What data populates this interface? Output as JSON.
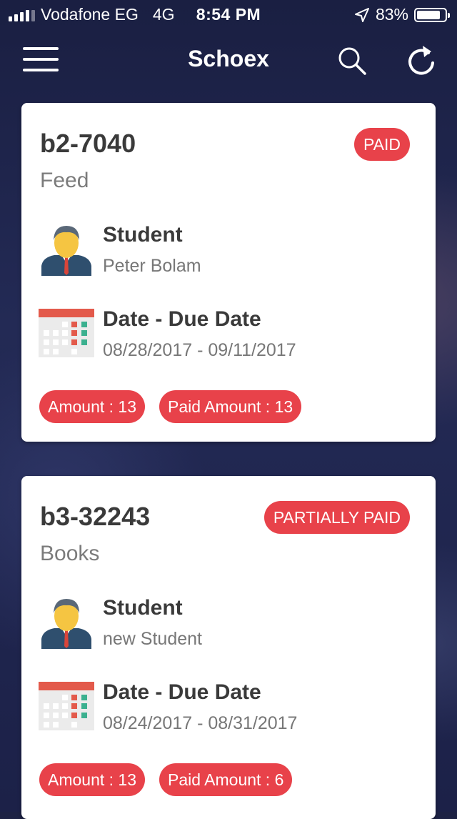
{
  "status_bar": {
    "carrier": "Vodafone EG",
    "network": "4G",
    "time": "8:54 PM",
    "battery": "83%",
    "battery_level": 0.83
  },
  "navbar": {
    "title": "Schoex",
    "icons": [
      "menu-icon",
      "search-icon",
      "refresh-icon"
    ]
  },
  "invoices": [
    {
      "id": "b2-7040",
      "type": "Feed",
      "status": "PAID",
      "student_label": "Student",
      "student_name": "Peter Bolam",
      "date_label": "Date - Due Date",
      "dates": "08/28/2017 - 09/11/2017",
      "amount": "Amount : 13",
      "paid_amount": "Paid Amount : 13"
    },
    {
      "id": "b3-32243",
      "type": "Books",
      "status": "PARTIALLY PAID",
      "student_label": "Student",
      "student_name": "new Student",
      "date_label": "Date - Due Date",
      "dates": "08/24/2017 - 08/31/2017",
      "amount": "Amount : 13",
      "paid_amount": "Paid Amount : 6"
    }
  ],
  "colors": {
    "accent": "#e8424a",
    "background": "#1d2244",
    "card": "#ffffff",
    "title_text": "#3a3a3a",
    "secondary_text": "#7b7b7b"
  }
}
